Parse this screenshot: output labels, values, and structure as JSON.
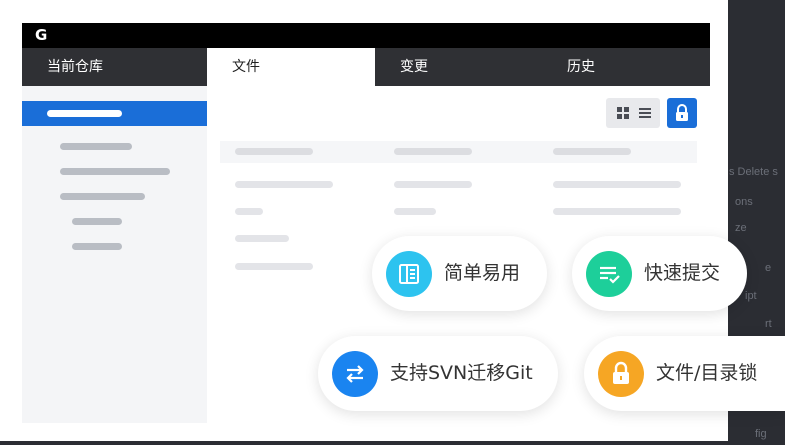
{
  "background_snippets": [
    "s Delete s",
    "ons",
    "ze",
    "e",
    "ipt",
    "rt",
    "fig"
  ],
  "app": {
    "logo": "G"
  },
  "tabs": [
    "当前仓库",
    "文件",
    "变更",
    "历史"
  ],
  "active_tab": "文件",
  "toolbar": {
    "view_icons": [
      "grid-icon",
      "list-icon"
    ],
    "lock_icon": "lock-icon"
  },
  "features": [
    {
      "label": "简单易用",
      "icon": "book-icon",
      "color": "#2dc3ef"
    },
    {
      "label": "快速提交",
      "icon": "checklist-icon",
      "color": "#1dcf9a"
    },
    {
      "label": "支持SVN迁移Git",
      "icon": "swap-arrows-icon",
      "color": "#1a84f0"
    },
    {
      "label": "文件/目录锁",
      "icon": "lock-icon",
      "color": "#f6a624"
    }
  ],
  "colors": {
    "accent": "#1a6ed8",
    "topbar": "#000000",
    "tabbar": "#2f3034",
    "sidebar": "#f4f5f7"
  }
}
